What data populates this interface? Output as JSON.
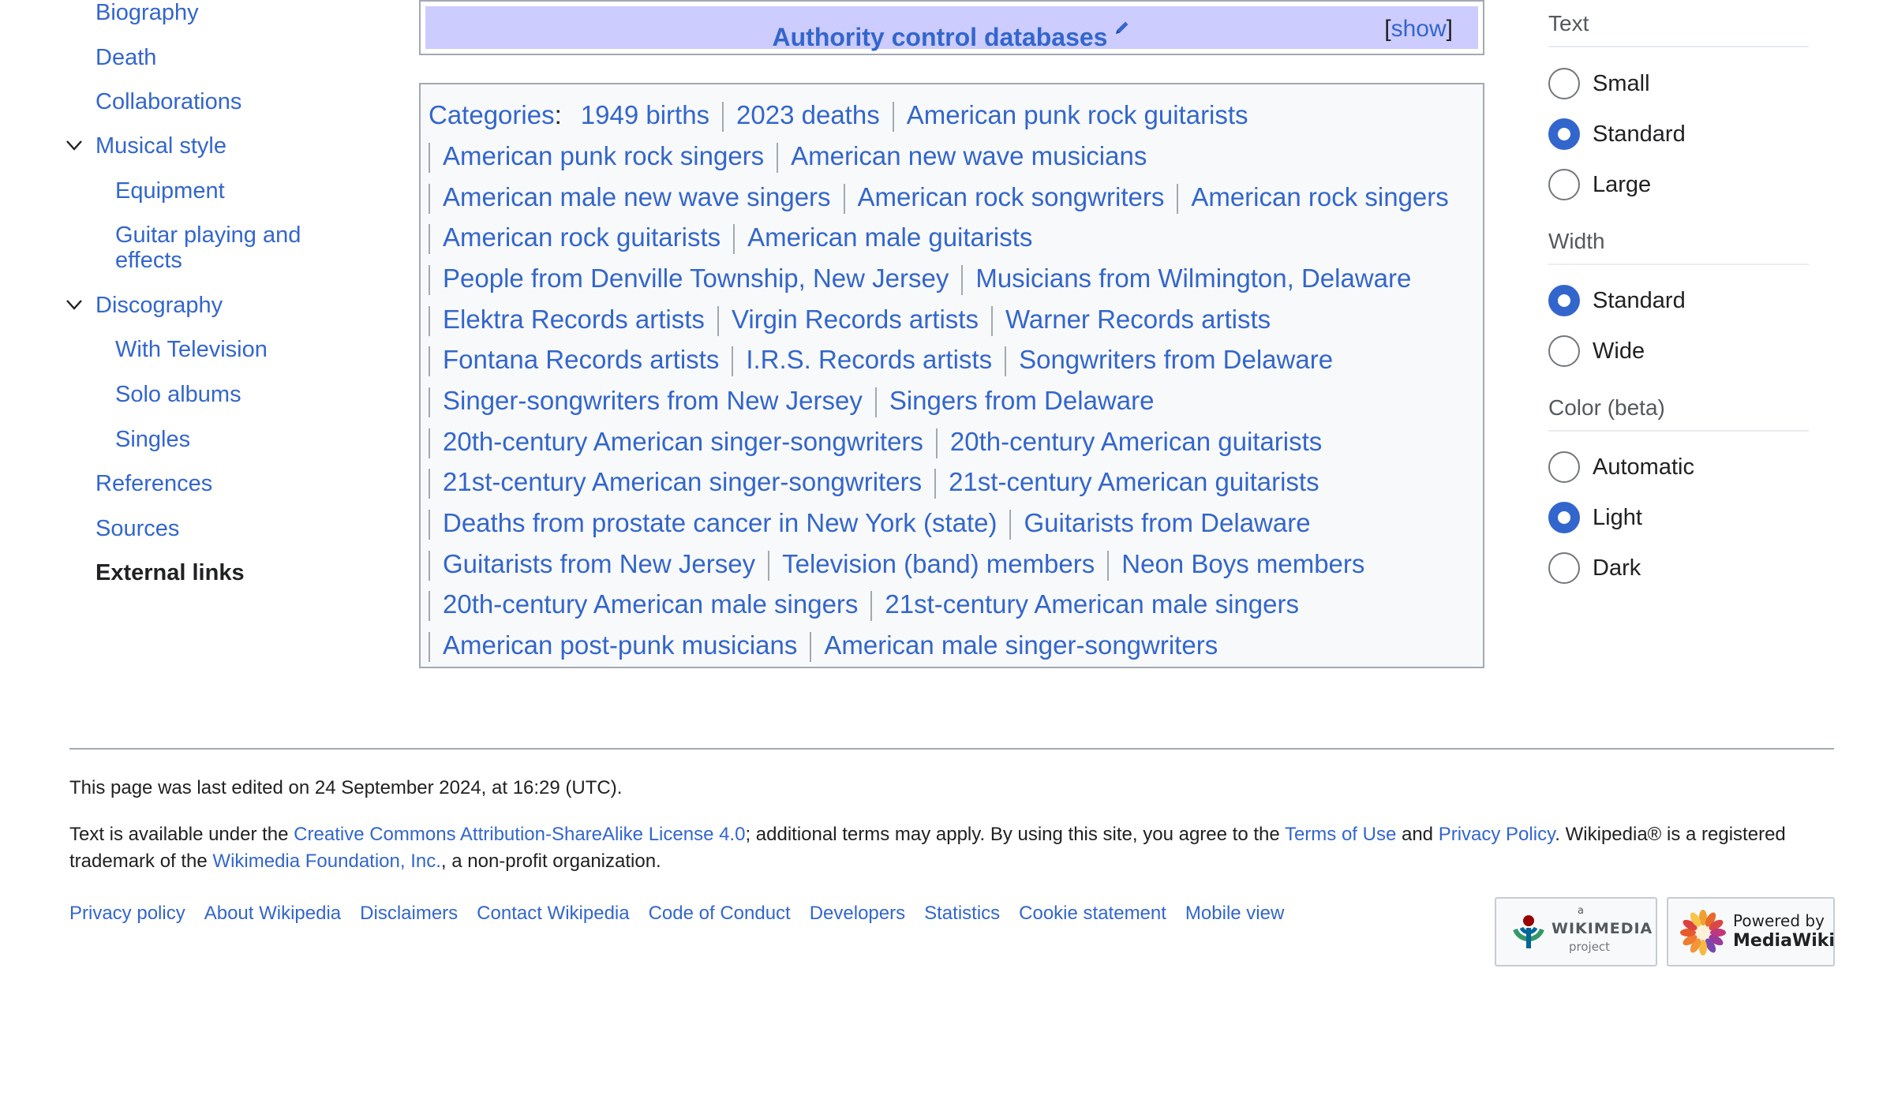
{
  "toc": {
    "items": [
      {
        "label": "Biography"
      },
      {
        "label": "Death"
      },
      {
        "label": "Collaborations"
      },
      {
        "label": "Musical style"
      },
      {
        "label": "Equipment"
      },
      {
        "label": "Guitar playing and effects"
      },
      {
        "label": "Discography"
      },
      {
        "label": "With Television"
      },
      {
        "label": "Solo albums"
      },
      {
        "label": "Singles"
      },
      {
        "label": "References"
      },
      {
        "label": "Sources"
      },
      {
        "label": "External links"
      }
    ],
    "guitar_line1": "Guitar playing and",
    "guitar_line2": "effects"
  },
  "navbox": {
    "title": "Authority control databases",
    "show_open": "[",
    "show_label": "show",
    "show_close": "]"
  },
  "categories": {
    "label": "Categories",
    "colon": ":",
    "items": [
      "1949 births",
      "2023 deaths",
      "American punk rock guitarists",
      "American punk rock singers",
      "American new wave musicians",
      "American male new wave singers",
      "American rock songwriters",
      "American rock singers",
      "American rock guitarists",
      "American male guitarists",
      "People from Denville Township, New Jersey",
      "Musicians from Wilmington, Delaware",
      "Elektra Records artists",
      "Virgin Records artists",
      "Warner Records artists",
      "Fontana Records artists",
      "I.R.S. Records artists",
      "Songwriters from Delaware",
      "Singer-songwriters from New Jersey",
      "Singers from Delaware",
      "20th-century American singer-songwriters",
      "20th-century American guitarists",
      "21st-century American singer-songwriters",
      "21st-century American guitarists",
      "Deaths from prostate cancer in New York (state)",
      "Guitarists from Delaware",
      "Guitarists from New Jersey",
      "Television (band) members",
      "Neon Boys members",
      "20th-century American male singers",
      "21st-century American male singers",
      "American post-punk musicians",
      "American male singer-songwriters"
    ]
  },
  "appearance": {
    "text_heading": "Text",
    "text_options": [
      {
        "label": "Small",
        "checked": false
      },
      {
        "label": "Standard",
        "checked": true
      },
      {
        "label": "Large",
        "checked": false
      }
    ],
    "width_heading": "Width",
    "width_options": [
      {
        "label": "Standard",
        "checked": true
      },
      {
        "label": "Wide",
        "checked": false
      }
    ],
    "color_heading": "Color (beta)",
    "color_options": [
      {
        "label": "Automatic",
        "checked": false
      },
      {
        "label": "Light",
        "checked": true
      },
      {
        "label": "Dark",
        "checked": false
      }
    ],
    "accent_color": "#3366cc"
  },
  "footer": {
    "last_edited": "This page was last edited on 24 September 2024, at 16:29 (UTC).",
    "license_1": "Text is available under the ",
    "license_link": "Creative Commons Attribution-ShareAlike License 4.0",
    "license_2": "; additional terms may apply. By using this site, you agree to the ",
    "terms_link": "Terms of Use",
    "license_3": " and ",
    "privacy_link": "Privacy Policy",
    "license_4": ". Wikipedia® is a registered trademark of the ",
    "foundation_link": "Wikimedia Foundation, Inc.",
    "license_5": ", a non-profit organization.",
    "links": [
      "Privacy policy",
      "About Wikipedia",
      "Disclaimers",
      "Contact Wikipedia",
      "Code of Conduct",
      "Developers",
      "Statistics",
      "Cookie statement",
      "Mobile view"
    ],
    "wikimedia_badge": {
      "small": "a",
      "name": "WIKIMEDIA",
      "sub": "project"
    },
    "mediawiki_badge": {
      "line1": "Powered by",
      "line2": "MediaWiki"
    }
  }
}
